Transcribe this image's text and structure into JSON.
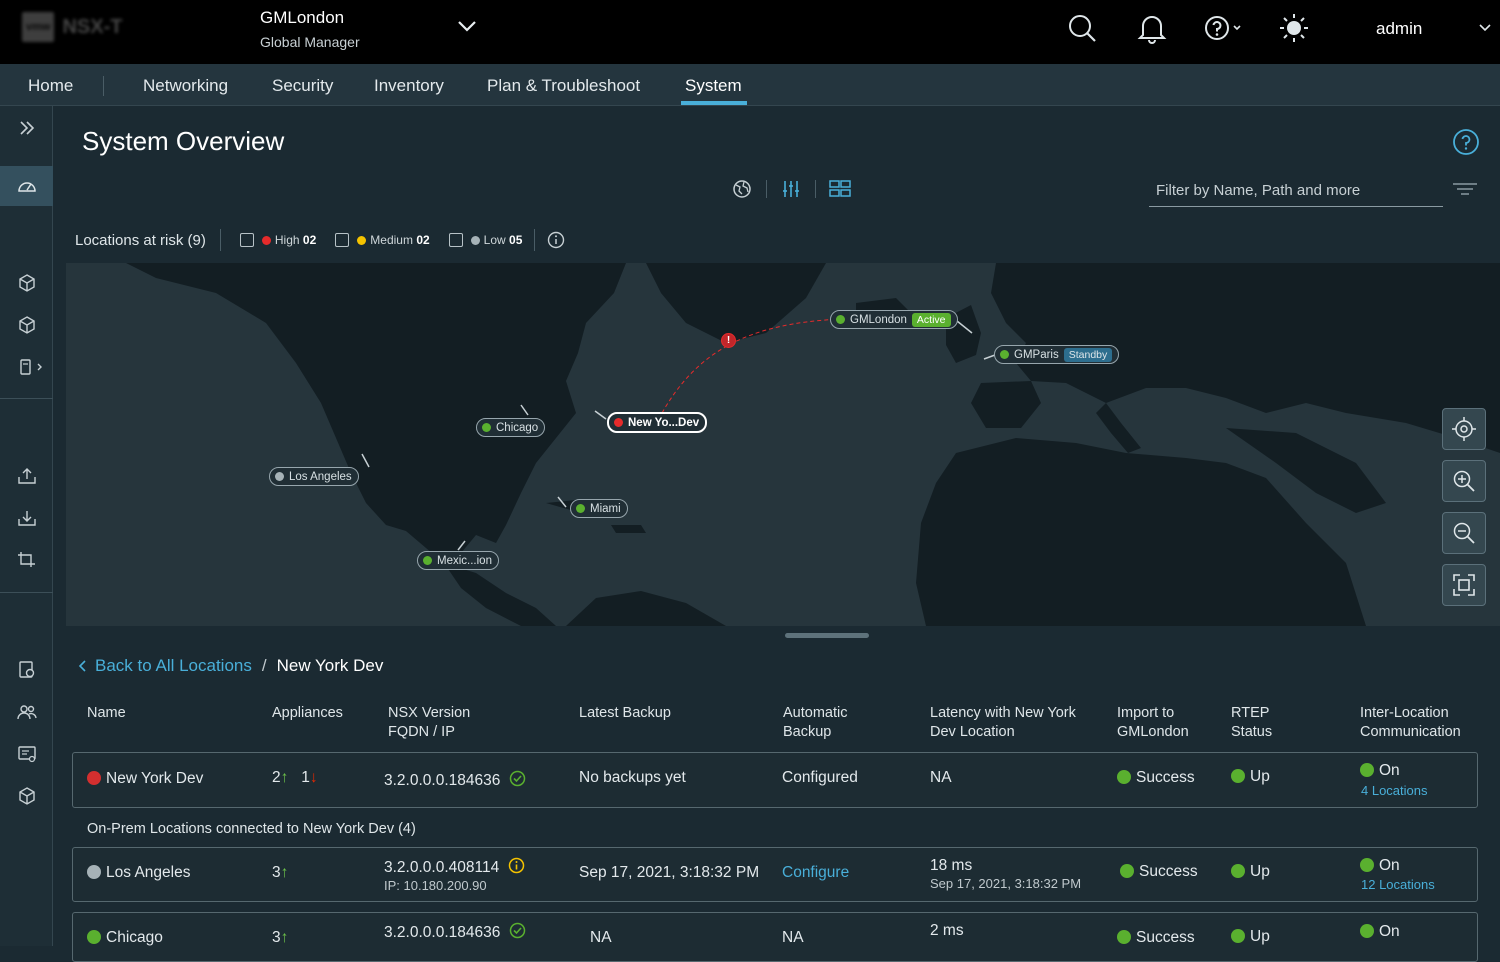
{
  "app": {
    "logo_mark": "vmw",
    "logo_name": "NSX-T"
  },
  "context": {
    "name": "GMLondon",
    "role": "Global Manager"
  },
  "topbar": {
    "user": "admin"
  },
  "nav": {
    "tabs": [
      "Home",
      "Networking",
      "Security",
      "Inventory",
      "Plan & Troubleshoot",
      "System"
    ],
    "active": "System"
  },
  "page": {
    "title": "System Overview",
    "filter_placeholder": "Filter by Name, Path and more"
  },
  "risk": {
    "label": "Locations at risk (9)",
    "high_label": "High",
    "high_count": "02",
    "medium_label": "Medium",
    "medium_count": "02",
    "low_label": "Low",
    "low_count": "05",
    "colors": {
      "high": "#e62b2b",
      "medium": "#f5c300",
      "low": "#a6b2b7"
    }
  },
  "map": {
    "locations": [
      {
        "label": "GMLondon",
        "badge": "Active",
        "status": "green"
      },
      {
        "label": "GMParis",
        "badge": "Standby",
        "status": "green"
      },
      {
        "label": "New Yo...Dev",
        "status": "red",
        "selected": true
      },
      {
        "label": "Chicago",
        "status": "green"
      },
      {
        "label": "Los Angeles",
        "status": "gray"
      },
      {
        "label": "Miami",
        "status": "green"
      },
      {
        "label": "Mexic...ion",
        "status": "green"
      }
    ]
  },
  "breadcrumb": {
    "back": "Back to All Locations",
    "current": "New York Dev"
  },
  "table": {
    "headers": {
      "name": "Name",
      "appliances": "Appliances",
      "nsx1": "NSX Version",
      "nsx2": "FQDN / IP",
      "backup": "Latest Backup",
      "auto1": "Automatic",
      "auto2": "Backup",
      "lat1": "Latency with New York",
      "lat2": "Dev Location",
      "imp1": "Import to",
      "imp2": "GMLondon",
      "rtep1": "RTEP",
      "rtep2": "Status",
      "inter1": "Inter-Location",
      "inter2": "Communication"
    },
    "primary": {
      "name": "New York Dev",
      "up_count": "2",
      "down_count": "1",
      "version": "3.2.0.0.0.184636",
      "backup": "No backups yet",
      "auto": "Configured",
      "latency": "NA",
      "import": "Success",
      "rtep": "Up",
      "inter": "On",
      "inter_link": "4 Locations"
    },
    "section_label": "On-Prem Locations connected to New York Dev (4)",
    "rows": [
      {
        "name": "Los Angeles",
        "up_count": "3",
        "version": "3.2.0.0.0.408114",
        "ip": "IP: 10.180.200.90",
        "backup": "Sep 17, 2021, 3:18:32 PM",
        "auto": "Configure",
        "latency": "18 ms",
        "latency_time": "Sep 17, 2021, 3:18:32 PM",
        "import": "Success",
        "rtep": "Up",
        "inter": "On",
        "inter_link": "12 Locations"
      },
      {
        "name": "Chicago",
        "up_count": "3",
        "version": "3.2.0.0.0.184636",
        "backup": "NA",
        "auto": "NA",
        "latency": "2 ms",
        "import": "Success",
        "rtep": "Up",
        "inter": "On"
      }
    ]
  }
}
